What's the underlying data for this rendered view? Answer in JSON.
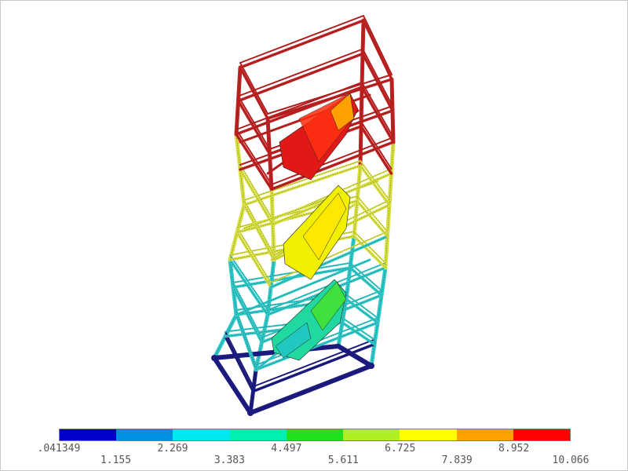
{
  "legend": {
    "colors": [
      "#0000c8",
      "#0090e0",
      "#00e8f0",
      "#00f0b0",
      "#20e020",
      "#b0f020",
      "#ffff00",
      "#ffa000",
      "#ff0000"
    ],
    "values": [
      ".041349",
      "1.155",
      "2.269",
      "3.383",
      "4.497",
      "5.611",
      "6.725",
      "7.839",
      "8.952",
      "10.066"
    ]
  },
  "structure": {
    "colors": {
      "base": "#1a1a80",
      "low": "#2ec8c8",
      "mid": "#d8e040",
      "high": "#c02020",
      "mesh": "#1a1a1a"
    }
  }
}
